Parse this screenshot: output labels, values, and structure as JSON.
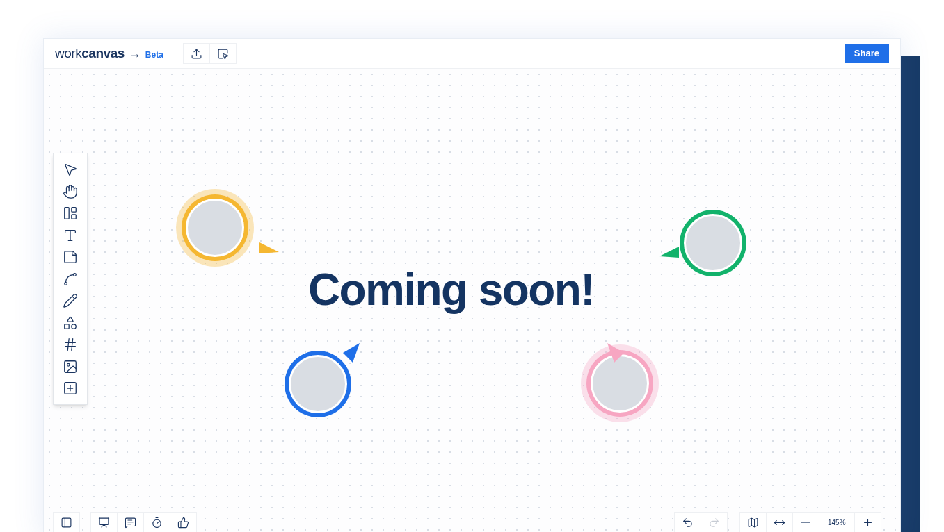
{
  "header": {
    "brand_light": "work",
    "brand_bold": "canvas",
    "arrow": "→",
    "badge": "Beta",
    "share_button": "Share"
  },
  "canvas": {
    "heading": "Coming soon!"
  },
  "collaborators": [
    {
      "color": "#f5b731",
      "glow": true,
      "kind": "east"
    },
    {
      "color": "#12b26b",
      "glow": false,
      "kind": "west"
    },
    {
      "color": "#1f6fe8",
      "glow": false,
      "kind": "northeast"
    },
    {
      "color": "#f7a6c2",
      "glow": true,
      "kind": "northwest"
    }
  ],
  "history": [
    {
      "kind": "undo",
      "disabled": false
    },
    {
      "kind": "redo",
      "disabled": true
    }
  ],
  "zoom": {
    "value": "145%"
  }
}
